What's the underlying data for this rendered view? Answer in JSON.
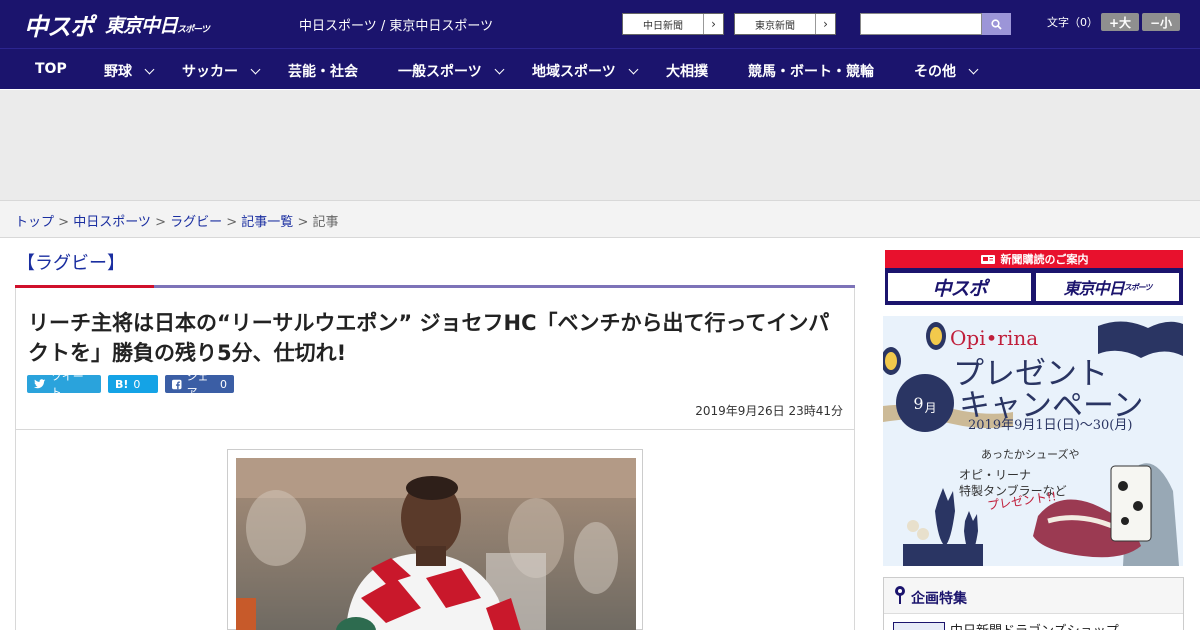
{
  "header": {
    "logo_main": "中スポ",
    "logo_sub": "東京中日",
    "logo_sub_small": "スポーツ",
    "site_names": "中日スポーツ / 東京中日スポーツ",
    "links": [
      {
        "label": "中日新聞",
        "arrow": "›"
      },
      {
        "label": "東京新聞",
        "arrow": "›"
      }
    ],
    "search_placeholder": "",
    "font_size_label": "文字（0）",
    "font_larger": "+大",
    "font_smaller": "−小"
  },
  "nav": [
    {
      "label": "TOP",
      "dropdown": false
    },
    {
      "label": "野球",
      "dropdown": true
    },
    {
      "label": "サッカー",
      "dropdown": true
    },
    {
      "label": "芸能・社会",
      "dropdown": false
    },
    {
      "label": "一般スポーツ",
      "dropdown": true
    },
    {
      "label": "地域スポーツ",
      "dropdown": true
    },
    {
      "label": "大相撲",
      "dropdown": false
    },
    {
      "label": "競馬・ボート・競輪",
      "dropdown": false
    },
    {
      "label": "その他",
      "dropdown": true
    }
  ],
  "breadcrumb": [
    {
      "label": "トップ",
      "link": true
    },
    {
      "label": "中日スポーツ",
      "link": true
    },
    {
      "label": "ラグビー",
      "link": true
    },
    {
      "label": "記事一覧",
      "link": true
    },
    {
      "label": "記事",
      "link": false
    }
  ],
  "breadcrumb_separator": " > ",
  "article": {
    "category": "【ラグビー】",
    "headline": "リーチ主将は日本の“リーサルウエポン” ジョセフHC「ベンチから出て行ってインパクトを」勝負の残り5分、仕切れ!",
    "share": {
      "tweet_label": "ツイート",
      "hatena_icon": "B!",
      "hatena_count": "0",
      "facebook_label": "シェア",
      "facebook_count": "0"
    },
    "date": "2019年9月26日 23時41分"
  },
  "sidebar": {
    "subscription_title": "新聞購読のご案内",
    "subscription_logos": [
      "中スポ",
      "東京中日"
    ],
    "subscription_logo_small": "スポーツ",
    "promo": {
      "brand": "Opi•rina",
      "title_line1": "プレゼント",
      "title_line2": "キャンペーン",
      "month_number": "9",
      "month_unit": "月",
      "dates": "2019年9月1日(日)〜30(月)",
      "copy_line1": "あったかシューズや",
      "copy_line2": "オピ・リーナ",
      "copy_line3": "特製タンブラーなど",
      "copy_line4": "プレゼント!!"
    },
    "feature_title": "企画特集",
    "feature_link": "中日新聞ドラゴンズショップ"
  },
  "colors": {
    "brand_navy": "#1b146d",
    "accent_red": "#d0102b",
    "link_blue": "#1a2ea0"
  }
}
